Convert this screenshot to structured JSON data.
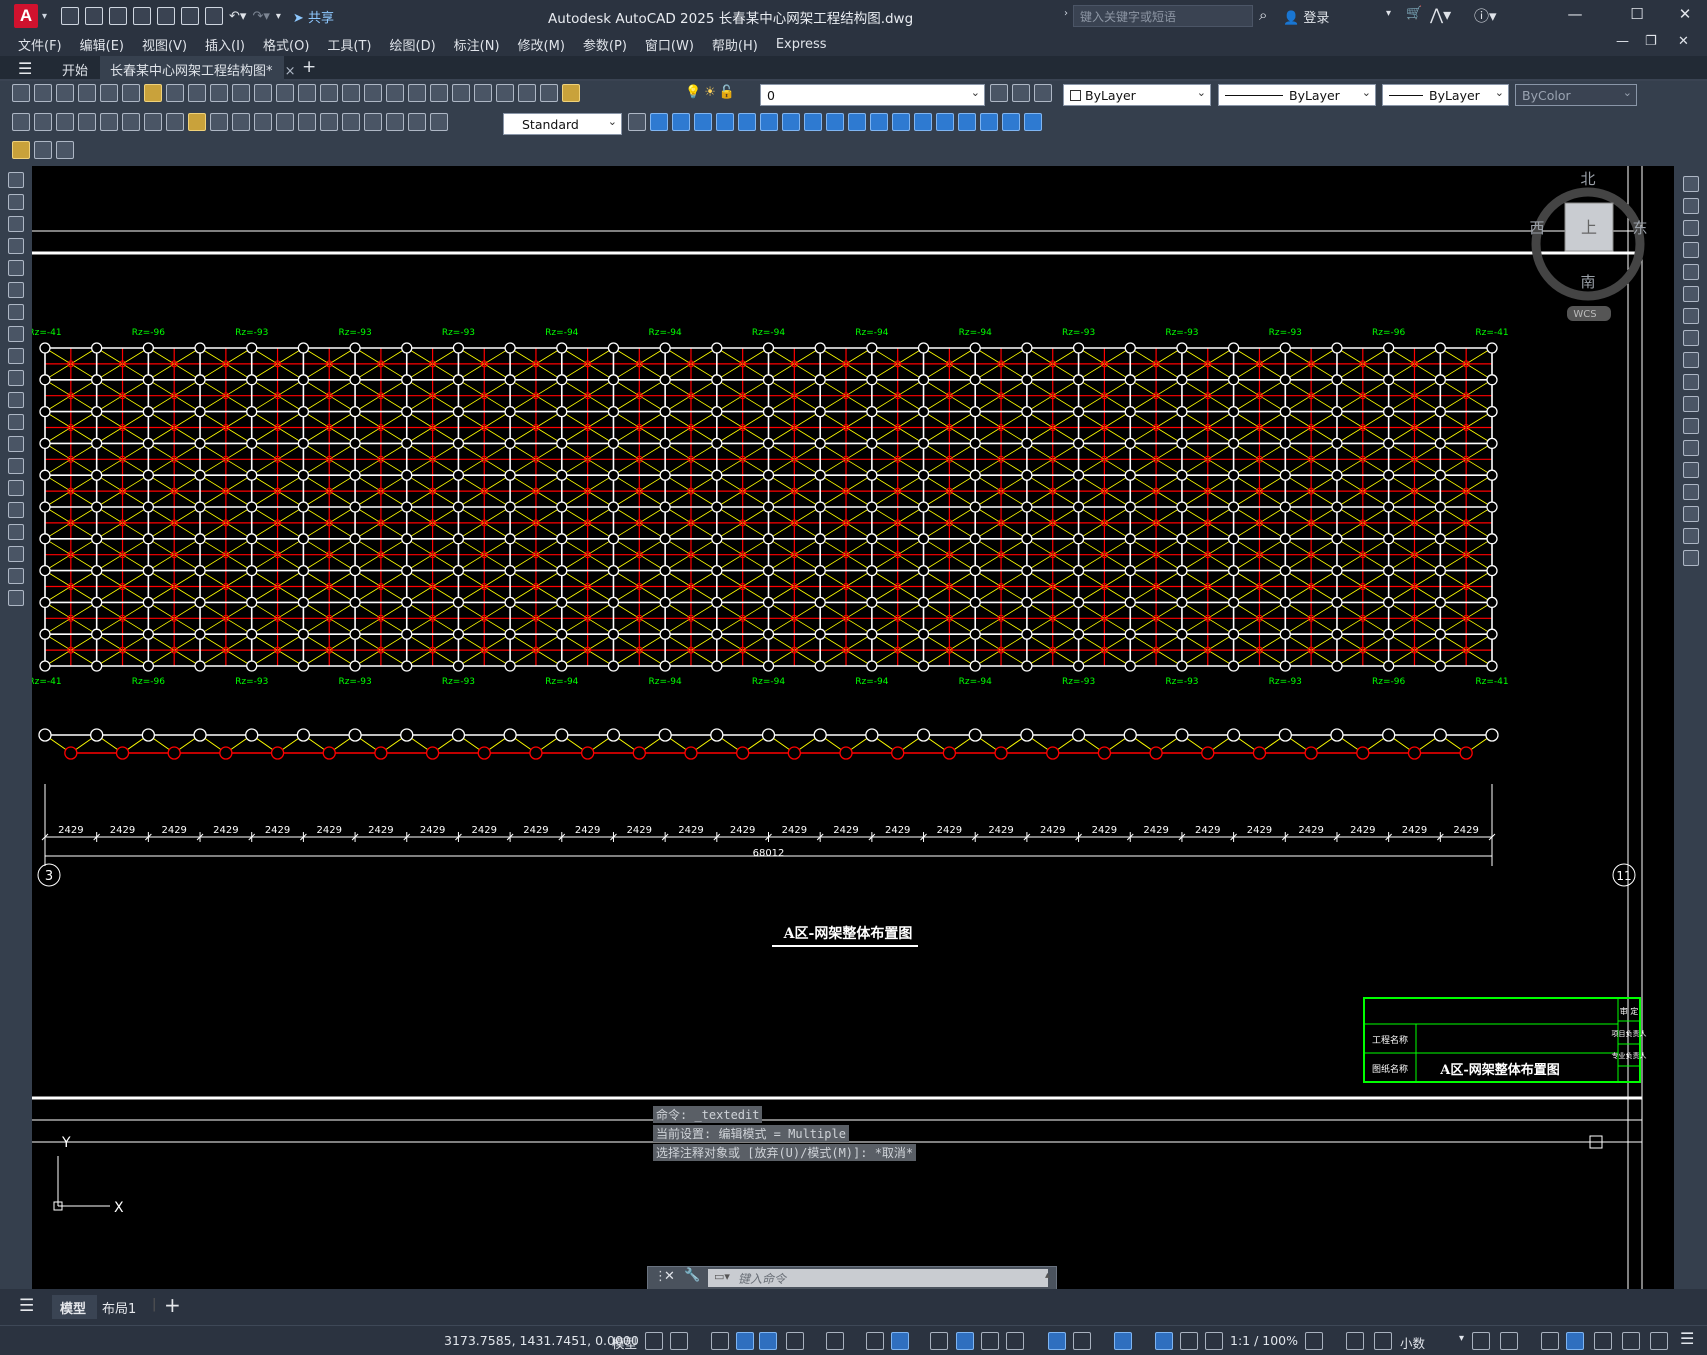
{
  "app": {
    "logo": "A",
    "window_title": "Autodesk AutoCAD 2025    长春某中心网架工程结构图.dwg",
    "share_label": "共享",
    "search_placeholder": "键入关键字或短语",
    "login_label": "登录"
  },
  "menu": [
    "文件(F)",
    "编辑(E)",
    "视图(V)",
    "插入(I)",
    "格式(O)",
    "工具(T)",
    "绘图(D)",
    "标注(N)",
    "修改(M)",
    "参数(P)",
    "窗口(W)",
    "帮助(H)",
    "Express"
  ],
  "tabs": {
    "start": "开始",
    "drawing": "长春某中心网架工程结构图*",
    "close": "×",
    "add": "+"
  },
  "properties": {
    "layer": "0",
    "color": "ByLayer",
    "linetype": "ByLayer",
    "lineweight": "ByLayer",
    "plotstyle": "ByColor",
    "textstyle": "Standard"
  },
  "viewcube": {
    "north": "北",
    "south": "南",
    "east": "东",
    "west": "西",
    "top": "上",
    "wcs": "WCS"
  },
  "drawing": {
    "support_labels_top": [
      "Rz=-41",
      "Rz=-96",
      "Rz=-93",
      "Rz=-93",
      "Rz=-93",
      "Rz=-94",
      "Rz=-94",
      "Rz=-94",
      "Rz=-94",
      "Rz=-94",
      "Rz=-93",
      "Rz=-93",
      "Rz=-93",
      "Rz=-96",
      "Rz=-41"
    ],
    "support_labels_bottom": [
      "Rz=-41",
      "Rz=-96",
      "Rz=-93",
      "Rz=-93",
      "Rz=-93",
      "Rz=-94",
      "Rz=-94",
      "Rz=-94",
      "Rz=-94",
      "Rz=-94",
      "Rz=-93",
      "Rz=-93",
      "Rz=-93",
      "Rz=-96",
      "Rz=-41"
    ],
    "dimension_value": "2429",
    "dimension_count": 28,
    "total_dimension": "68012",
    "axis_left": "3",
    "axis_right": "11",
    "plan_title": "A区-网架整体布置图",
    "axis_x": "X",
    "axis_y": "Y"
  },
  "title_block": {
    "project_label": "工程名称",
    "drawing_label": "图纸名称",
    "drawing_name": "A区-网架整体布置图",
    "approve_label": "审 定",
    "pm_label": "项目负责人",
    "eng_label": "专业负责人"
  },
  "command": {
    "history": [
      "命令: _textedit",
      "当前设置: 编辑模式 = Multiple",
      "选择注释对象或 [放弃(U)/模式(M)]: *取消*"
    ],
    "input_placeholder": "键入命令"
  },
  "layouts": {
    "model": "模型",
    "layout1": "布局1"
  },
  "status": {
    "coords": "3173.7585, 1431.7451, 0.0000",
    "model_label": "模型",
    "scale": "1:1 / 100%",
    "units": "小数"
  },
  "colors": {
    "grid": "#ffffff",
    "member_yellow": "#ffff00",
    "member_red": "#ff0000",
    "label_green": "#00ff00",
    "accent_blue": "#2f6fbf"
  }
}
